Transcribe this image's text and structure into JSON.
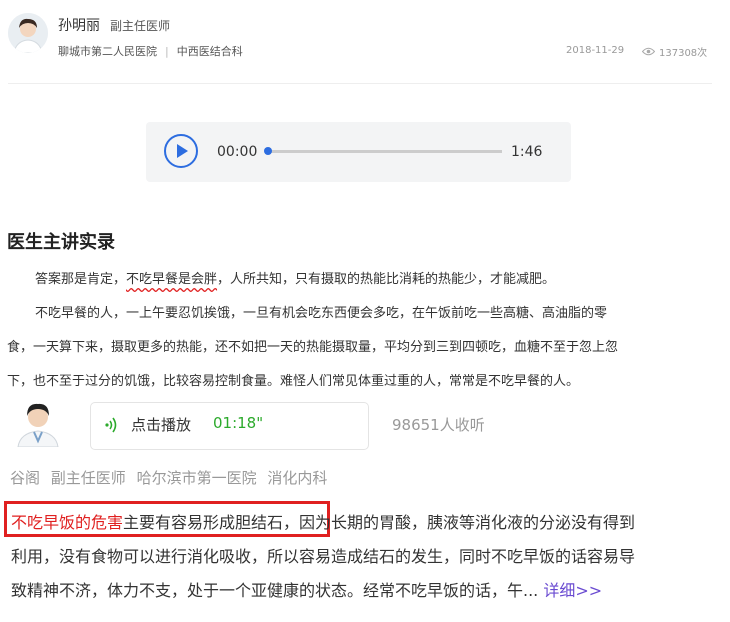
{
  "doctor": {
    "name": "孙明丽",
    "title": "副主任医师",
    "hospital": "聊城市第二人民医院",
    "department": "中西医结合科",
    "date": "2018-11-29",
    "views": "137308次"
  },
  "player": {
    "current_time": "00:00",
    "duration": "1:46",
    "progress": 0
  },
  "section": {
    "title": "医生主讲实录",
    "p1_a": "答案那是肯定，",
    "p1_b": "不吃早餐是会胖",
    "p1_c": "，人所共知，只有摄取的热能比消耗的热能少，才能减肥。",
    "p2_line1": "不吃早餐的人，一上午要忍饥挨饿，一旦有机会吃东西便会多吃，在午饭前吃一些高糖、高油脂的零",
    "p2_line2": "食，一天算下来，摄取更多的热能，还不如把一天的热能摄取量，平均分到三到四顿吃，血糖不至于忽上忽",
    "p2_line3": "下，也不至于过分的饥饿，比较容易控制食量。难怪人们常见体重过重的人，常常是不吃早餐的人。"
  },
  "voice_card": {
    "play_label": "点击播放",
    "time": "01:18\"",
    "listens": "98651人收听"
  },
  "doctor2": {
    "name": "谷阁",
    "title": "副主任医师",
    "hospital": "哈尔滨市第一医院",
    "department": "消化内科"
  },
  "excerpt": {
    "red_part": "不吃早饭的危害",
    "line1_rest": "主要有容易形成胆结石",
    "line1_after": "，因为长期的胃酸，胰液等消化液的分泌没有得到",
    "line2": "利用，没有食物可以进行消化吸收，所以容易造成结石的发生，同时不吃早饭的话容易导",
    "line3": "致精神不济，体力不支，处于一个亚健康的状态。经常不吃早饭的话，午...",
    "more": " 详细>>"
  },
  "colors": {
    "accent_blue": "#2d6de0",
    "highlight_red": "#e02020",
    "voice_green": "#2caa2c",
    "link_purple": "#6a4bd1"
  }
}
